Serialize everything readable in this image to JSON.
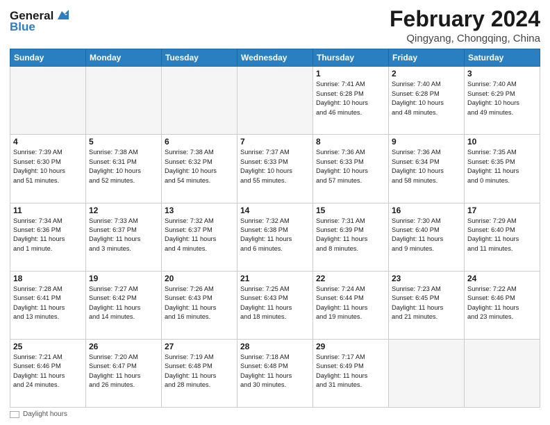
{
  "header": {
    "logo_line1": "General",
    "logo_line2": "Blue",
    "month_title": "February 2024",
    "location": "Qingyang, Chongqing, China"
  },
  "weekdays": [
    "Sunday",
    "Monday",
    "Tuesday",
    "Wednesday",
    "Thursday",
    "Friday",
    "Saturday"
  ],
  "weeks": [
    [
      {
        "day": "",
        "info": "",
        "empty": true
      },
      {
        "day": "",
        "info": "",
        "empty": true
      },
      {
        "day": "",
        "info": "",
        "empty": true
      },
      {
        "day": "",
        "info": "",
        "empty": true
      },
      {
        "day": "1",
        "info": "Sunrise: 7:41 AM\nSunset: 6:28 PM\nDaylight: 10 hours\nand 46 minutes."
      },
      {
        "day": "2",
        "info": "Sunrise: 7:40 AM\nSunset: 6:28 PM\nDaylight: 10 hours\nand 48 minutes."
      },
      {
        "day": "3",
        "info": "Sunrise: 7:40 AM\nSunset: 6:29 PM\nDaylight: 10 hours\nand 49 minutes."
      }
    ],
    [
      {
        "day": "4",
        "info": "Sunrise: 7:39 AM\nSunset: 6:30 PM\nDaylight: 10 hours\nand 51 minutes."
      },
      {
        "day": "5",
        "info": "Sunrise: 7:38 AM\nSunset: 6:31 PM\nDaylight: 10 hours\nand 52 minutes."
      },
      {
        "day": "6",
        "info": "Sunrise: 7:38 AM\nSunset: 6:32 PM\nDaylight: 10 hours\nand 54 minutes."
      },
      {
        "day": "7",
        "info": "Sunrise: 7:37 AM\nSunset: 6:33 PM\nDaylight: 10 hours\nand 55 minutes."
      },
      {
        "day": "8",
        "info": "Sunrise: 7:36 AM\nSunset: 6:33 PM\nDaylight: 10 hours\nand 57 minutes."
      },
      {
        "day": "9",
        "info": "Sunrise: 7:36 AM\nSunset: 6:34 PM\nDaylight: 10 hours\nand 58 minutes."
      },
      {
        "day": "10",
        "info": "Sunrise: 7:35 AM\nSunset: 6:35 PM\nDaylight: 11 hours\nand 0 minutes."
      }
    ],
    [
      {
        "day": "11",
        "info": "Sunrise: 7:34 AM\nSunset: 6:36 PM\nDaylight: 11 hours\nand 1 minute."
      },
      {
        "day": "12",
        "info": "Sunrise: 7:33 AM\nSunset: 6:37 PM\nDaylight: 11 hours\nand 3 minutes."
      },
      {
        "day": "13",
        "info": "Sunrise: 7:32 AM\nSunset: 6:37 PM\nDaylight: 11 hours\nand 4 minutes."
      },
      {
        "day": "14",
        "info": "Sunrise: 7:32 AM\nSunset: 6:38 PM\nDaylight: 11 hours\nand 6 minutes."
      },
      {
        "day": "15",
        "info": "Sunrise: 7:31 AM\nSunset: 6:39 PM\nDaylight: 11 hours\nand 8 minutes."
      },
      {
        "day": "16",
        "info": "Sunrise: 7:30 AM\nSunset: 6:40 PM\nDaylight: 11 hours\nand 9 minutes."
      },
      {
        "day": "17",
        "info": "Sunrise: 7:29 AM\nSunset: 6:40 PM\nDaylight: 11 hours\nand 11 minutes."
      }
    ],
    [
      {
        "day": "18",
        "info": "Sunrise: 7:28 AM\nSunset: 6:41 PM\nDaylight: 11 hours\nand 13 minutes."
      },
      {
        "day": "19",
        "info": "Sunrise: 7:27 AM\nSunset: 6:42 PM\nDaylight: 11 hours\nand 14 minutes."
      },
      {
        "day": "20",
        "info": "Sunrise: 7:26 AM\nSunset: 6:43 PM\nDaylight: 11 hours\nand 16 minutes."
      },
      {
        "day": "21",
        "info": "Sunrise: 7:25 AM\nSunset: 6:43 PM\nDaylight: 11 hours\nand 18 minutes."
      },
      {
        "day": "22",
        "info": "Sunrise: 7:24 AM\nSunset: 6:44 PM\nDaylight: 11 hours\nand 19 minutes."
      },
      {
        "day": "23",
        "info": "Sunrise: 7:23 AM\nSunset: 6:45 PM\nDaylight: 11 hours\nand 21 minutes."
      },
      {
        "day": "24",
        "info": "Sunrise: 7:22 AM\nSunset: 6:46 PM\nDaylight: 11 hours\nand 23 minutes."
      }
    ],
    [
      {
        "day": "25",
        "info": "Sunrise: 7:21 AM\nSunset: 6:46 PM\nDaylight: 11 hours\nand 24 minutes."
      },
      {
        "day": "26",
        "info": "Sunrise: 7:20 AM\nSunset: 6:47 PM\nDaylight: 11 hours\nand 26 minutes."
      },
      {
        "day": "27",
        "info": "Sunrise: 7:19 AM\nSunset: 6:48 PM\nDaylight: 11 hours\nand 28 minutes."
      },
      {
        "day": "28",
        "info": "Sunrise: 7:18 AM\nSunset: 6:48 PM\nDaylight: 11 hours\nand 30 minutes."
      },
      {
        "day": "29",
        "info": "Sunrise: 7:17 AM\nSunset: 6:49 PM\nDaylight: 11 hours\nand 31 minutes."
      },
      {
        "day": "",
        "info": "",
        "empty": true
      },
      {
        "day": "",
        "info": "",
        "empty": true
      }
    ]
  ],
  "footer": {
    "legend_label": "Daylight hours"
  }
}
